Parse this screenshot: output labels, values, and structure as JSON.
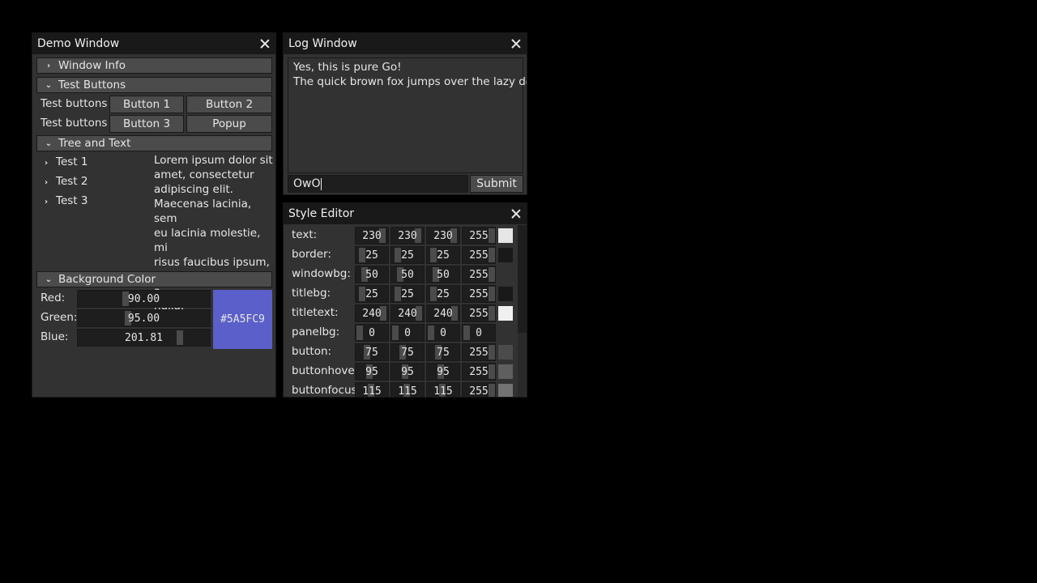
{
  "demo_window": {
    "title": "Demo Window",
    "sections": {
      "window_info": {
        "label": "Window Info",
        "expanded": false
      },
      "test_buttons": {
        "label": "Test Buttons",
        "expanded": true
      },
      "tree_and_text": {
        "label": "Tree and Text",
        "expanded": true
      },
      "background_color": {
        "label": "Background Color",
        "expanded": true
      }
    },
    "button_rows": [
      {
        "label": "Test buttons",
        "buttons": [
          "Button 1",
          "Button 2"
        ]
      },
      {
        "label": "Test buttons",
        "buttons": [
          "Button 3",
          "Popup"
        ]
      }
    ],
    "tree_items": [
      "Test 1",
      "Test 2",
      "Test 3"
    ],
    "lorem_lines": [
      "Lorem ipsum dolor sit",
      "amet, consectetur",
      "adipiscing elit.",
      "Maecenas lacinia, sem",
      "eu lacinia molestie, mi",
      "risus faucibus ipsum,",
      "eu varius magna felis a",
      "nulla."
    ],
    "color_sliders": [
      {
        "label": "Red:",
        "value": "90.00",
        "fraction": 0.353
      },
      {
        "label": "Green:",
        "value": "95.00",
        "fraction": 0.373
      },
      {
        "label": "Blue:",
        "value": "201.81",
        "fraction": 0.791
      }
    ],
    "color_preview": {
      "hex": "#5A5FC9"
    }
  },
  "log_window": {
    "title": "Log Window",
    "lines": [
      "Yes, this is pure Go!",
      "The quick brown fox jumps over the lazy dog"
    ],
    "input_value": "OwO",
    "submit_label": "Submit"
  },
  "style_editor": {
    "title": "Style Editor",
    "rows": [
      {
        "label": "text:",
        "values": [
          230,
          230,
          230,
          255
        ],
        "swatch": "#e6e6e6"
      },
      {
        "label": "border:",
        "values": [
          25,
          25,
          25,
          255
        ],
        "swatch": "#191919"
      },
      {
        "label": "windowbg:",
        "values": [
          50,
          50,
          50,
          255
        ],
        "swatch": "#323232"
      },
      {
        "label": "titlebg:",
        "values": [
          25,
          25,
          25,
          255
        ],
        "swatch": "#191919"
      },
      {
        "label": "titletext:",
        "values": [
          240,
          240,
          240,
          255
        ],
        "swatch": "#f0f0f0"
      },
      {
        "label": "panelbg:",
        "values": [
          0,
          0,
          0,
          0
        ],
        "swatch": "transparent"
      },
      {
        "label": "button:",
        "values": [
          75,
          75,
          75,
          255
        ],
        "swatch": "#4b4b4b"
      },
      {
        "label": "buttonhover",
        "values": [
          95,
          95,
          95,
          255
        ],
        "swatch": "#5f5f5f"
      },
      {
        "label": "buttonfocus:",
        "values": [
          115,
          115,
          115,
          255
        ],
        "swatch": "#737373"
      }
    ]
  }
}
